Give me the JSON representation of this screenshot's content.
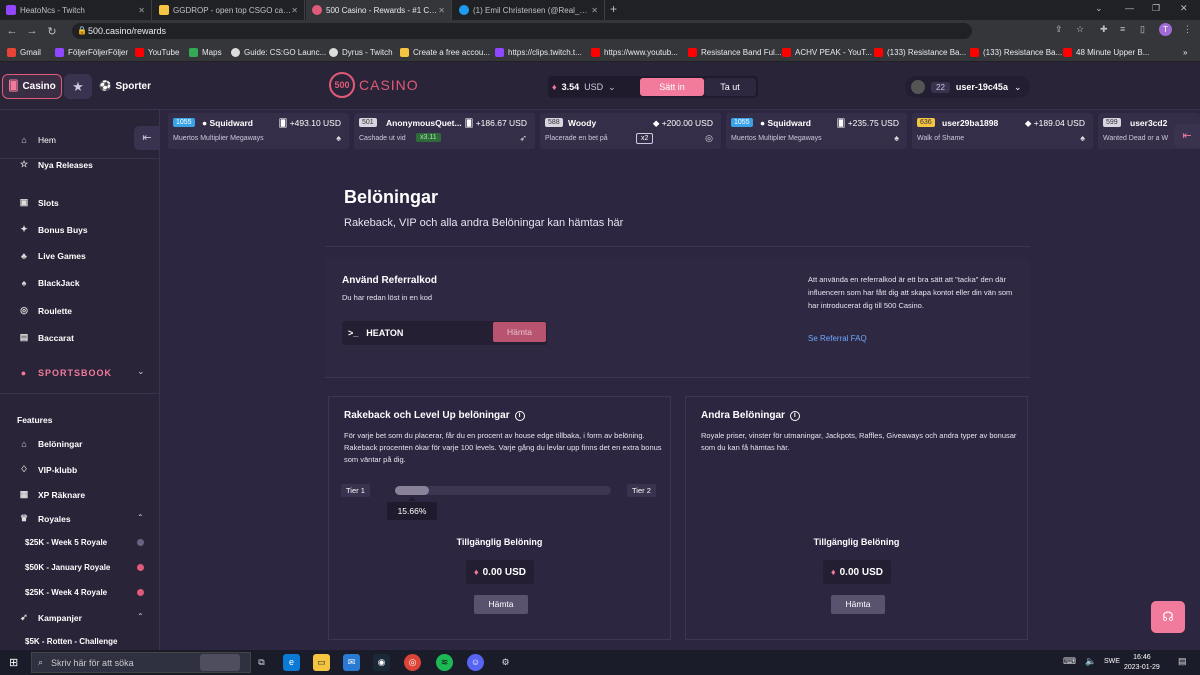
{
  "browser": {
    "tabs": [
      {
        "title": "HeatoNcs - Twitch",
        "color": "#9146ff"
      },
      {
        "title": "GGDROP - open top CSGO cases",
        "color": "#f5c542"
      },
      {
        "title": "500 Casino - Rewards - #1 CSGO",
        "color": "#e05b7a"
      },
      {
        "title": "(1) Emil Christensen (@Real_Heat",
        "color": "#1d9bf0"
      }
    ],
    "url": "500.casino/rewards",
    "bookmarks": [
      {
        "label": "Gmail",
        "color": "#ea4335"
      },
      {
        "label": "FöljerFöljerFöljer",
        "color": "#9146ff"
      },
      {
        "label": "YouTube",
        "color": "#ff0000"
      },
      {
        "label": "Maps",
        "color": "#34a853"
      },
      {
        "label": "Guide: CS:GO Launc...",
        "color": "#dddddd"
      },
      {
        "label": "Dyrus - Twitch",
        "color": "#dddddd"
      },
      {
        "label": "Create a free accou...",
        "color": "#f5c542"
      },
      {
        "label": "https://clips.twitch.t...",
        "color": "#9146ff"
      },
      {
        "label": "https://www.youtub...",
        "color": "#ff0000"
      },
      {
        "label": "Resistance Band Ful...",
        "color": "#ff0000"
      },
      {
        "label": "ACHV PEAK - YouT...",
        "color": "#ff0000"
      },
      {
        "label": "(133) Resistance Ba...",
        "color": "#ff0000"
      },
      {
        "label": "(133) Resistance Ba...",
        "color": "#ff0000"
      },
      {
        "label": "48 Minute Upper B...",
        "color": "#ff0000"
      }
    ]
  },
  "header": {
    "casino_label": "Casino",
    "sports_label": "Sporter",
    "logo_number": "500",
    "logo_word": "CASINO",
    "balance": "3.54",
    "currency": "USD",
    "deposit_label": "Sätt in",
    "withdraw_label": "Ta ut",
    "user_level": "22",
    "username": "user-19c45a"
  },
  "sidebar": {
    "home": "Hem",
    "items": [
      "Nya Releases",
      "Slots",
      "Bonus Buys",
      "Live Games",
      "BlackJack",
      "Roulette",
      "Baccarat"
    ],
    "sportsbook": "SPORTSBOOK",
    "features_heading": "Features",
    "features": [
      "Belöningar",
      "VIP-klubb",
      "XP Räknare",
      "Royales"
    ],
    "royales": [
      {
        "label": "$25K - Week 5 Royale",
        "dot": "#6b6480"
      },
      {
        "label": "$50K - January Royale",
        "dot": "#e05b7a"
      },
      {
        "label": "$25K - Week 4 Royale",
        "dot": "#e05b7a"
      }
    ],
    "campaigns": "Kampanjer",
    "campaign_items": [
      "$5K - Rotten - Challenge"
    ]
  },
  "wins": [
    {
      "level": "1055",
      "name": "Squidward",
      "amount": "+493.10 USD",
      "game": "Muertos Multiplier Megaways",
      "mult": ""
    },
    {
      "level": "501",
      "name": "AnonymousQuet...",
      "amount": "+186.67 USD",
      "game": "Cashade ut vid",
      "mult": "x3.11"
    },
    {
      "level": "588",
      "name": "Woody",
      "amount": "+200.00 USD",
      "game": "Placerade en bet på",
      "mult": "x2"
    },
    {
      "level": "1055",
      "name": "Squidward",
      "amount": "+235.75 USD",
      "game": "Muertos Multiplier Megaways",
      "mult": ""
    },
    {
      "level": "636",
      "name": "user29ba1898",
      "amount": "+189.04 USD",
      "game": "Walk of Shame",
      "mult": ""
    },
    {
      "level": "599",
      "name": "user3cd2",
      "amount": "",
      "game": "Wanted Dead or a W",
      "mult": ""
    }
  ],
  "page": {
    "title": "Belöningar",
    "subtitle": "Rakeback, VIP och alla andra Belöningar kan hämtas här"
  },
  "referral": {
    "title": "Använd Referralkod",
    "subtitle": "Du har redan löst in en kod",
    "code": "HEATON",
    "button": "Hämta",
    "info": "Att använda en referralkod är ett bra sätt att \"tacka\" den där influencern som har fått dig att skapa kontot eller din vän som har introducerat dig till 500 Casino.",
    "faq_link": "Se Referral FAQ"
  },
  "rakeback": {
    "title": "Rakeback och Level Up belöningar",
    "description": "För varje bet som du placerar, får du en procent av house edge tillbaka, i form av belöning. Rakeback procenten ökar för varje 100 levels. Varje gång du levlar upp finns det en extra bonus som väntar på dig.",
    "tier_from": "Tier 1",
    "tier_to": "Tier 2",
    "progress_label": "15.66%",
    "progress_fraction": 0.1566,
    "available_label": "Tillgänglig Belöning",
    "amount": "0.00 USD",
    "button": "Hämta"
  },
  "other": {
    "title": "Andra Belöningar",
    "description": "Royale priser, vinster för utmaningar, Jackpots, Raffles, Giveaways och andra typer av bonusar som du kan få hämtas här.",
    "available_label": "Tillgänglig Belöning",
    "amount": "0.00 USD",
    "button": "Hämta"
  },
  "taskbar": {
    "search_placeholder": "Skriv här för att söka",
    "language": "SWE",
    "time": "16:46",
    "date": "2023-01-29"
  },
  "colors": {
    "accent": "#f27a9b",
    "brand": "#e05b7a",
    "link": "#6ea8ff"
  }
}
